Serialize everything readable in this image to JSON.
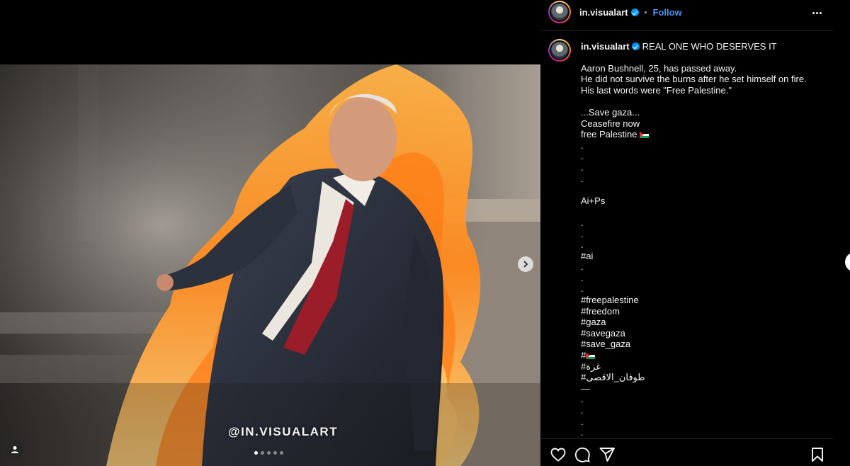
{
  "post": {
    "username": "in.visualart",
    "follow_label": "Follow",
    "separator": "•",
    "watermark": "@IN.VISUALART",
    "carousel": {
      "total": 5,
      "active_index": 0
    }
  },
  "caption": {
    "title": "REAL ONE WHO DESERVES IT",
    "lines": [
      "Aaron Bushnell, 25, has passed away.",
      "He did not survive the burns after he set himself on fire.",
      "His last words were \"Free Palestine.\"",
      "",
      "...Save gaza...",
      "Ceasefire now",
      "free Palestine ",
      ".",
      ".",
      ".",
      ".",
      "",
      "Ai+Ps",
      "",
      ".",
      ".",
      ".",
      "#ai",
      ".",
      ".",
      ".",
      "#freepalestine",
      "#freedom",
      "#gaza",
      "#savegaza",
      "#save_gaza",
      "#",
      "#غزة",
      "#طوفان_الاقصى",
      "—",
      ".",
      ".",
      ".",
      "."
    ],
    "flag_line_indexes": [
      6,
      26
    ]
  },
  "icons": {
    "verified": "verified-badge-icon",
    "more": "more-options-icon",
    "next": "chevron-right-icon",
    "tag": "user-tag-icon",
    "like": "heart-icon",
    "comment": "comment-icon",
    "share": "send-icon",
    "save": "bookmark-icon"
  },
  "colors": {
    "background": "#000000",
    "follow": "#4493f8",
    "verified": "#0095f6",
    "divider": "#262626"
  }
}
